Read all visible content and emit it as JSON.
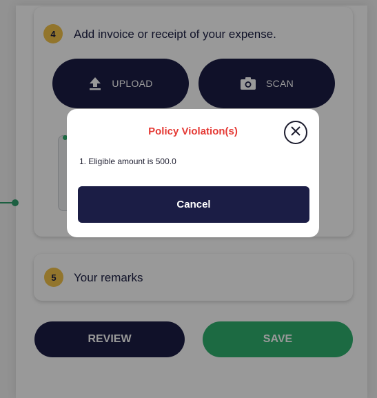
{
  "step4": {
    "number": "4",
    "title": "Add invoice or receipt of your expense.",
    "upload_label": "UPLOAD",
    "scan_label": "SCAN",
    "upload_icon": "upload-icon",
    "scan_icon": "camera-icon"
  },
  "step5": {
    "number": "5",
    "title": "Your remarks"
  },
  "actions": {
    "review_label": "REVIEW",
    "save_label": "SAVE"
  },
  "modal": {
    "title": "Policy Violation(s)",
    "message": "1. Eligible amount is 500.0",
    "cancel_label": "Cancel",
    "close_icon": "close-circle-icon"
  },
  "colors": {
    "navy": "#1b1d45",
    "green": "#2fb16f",
    "badge_yellow": "#f3c34a",
    "error_red": "#e53a35"
  }
}
